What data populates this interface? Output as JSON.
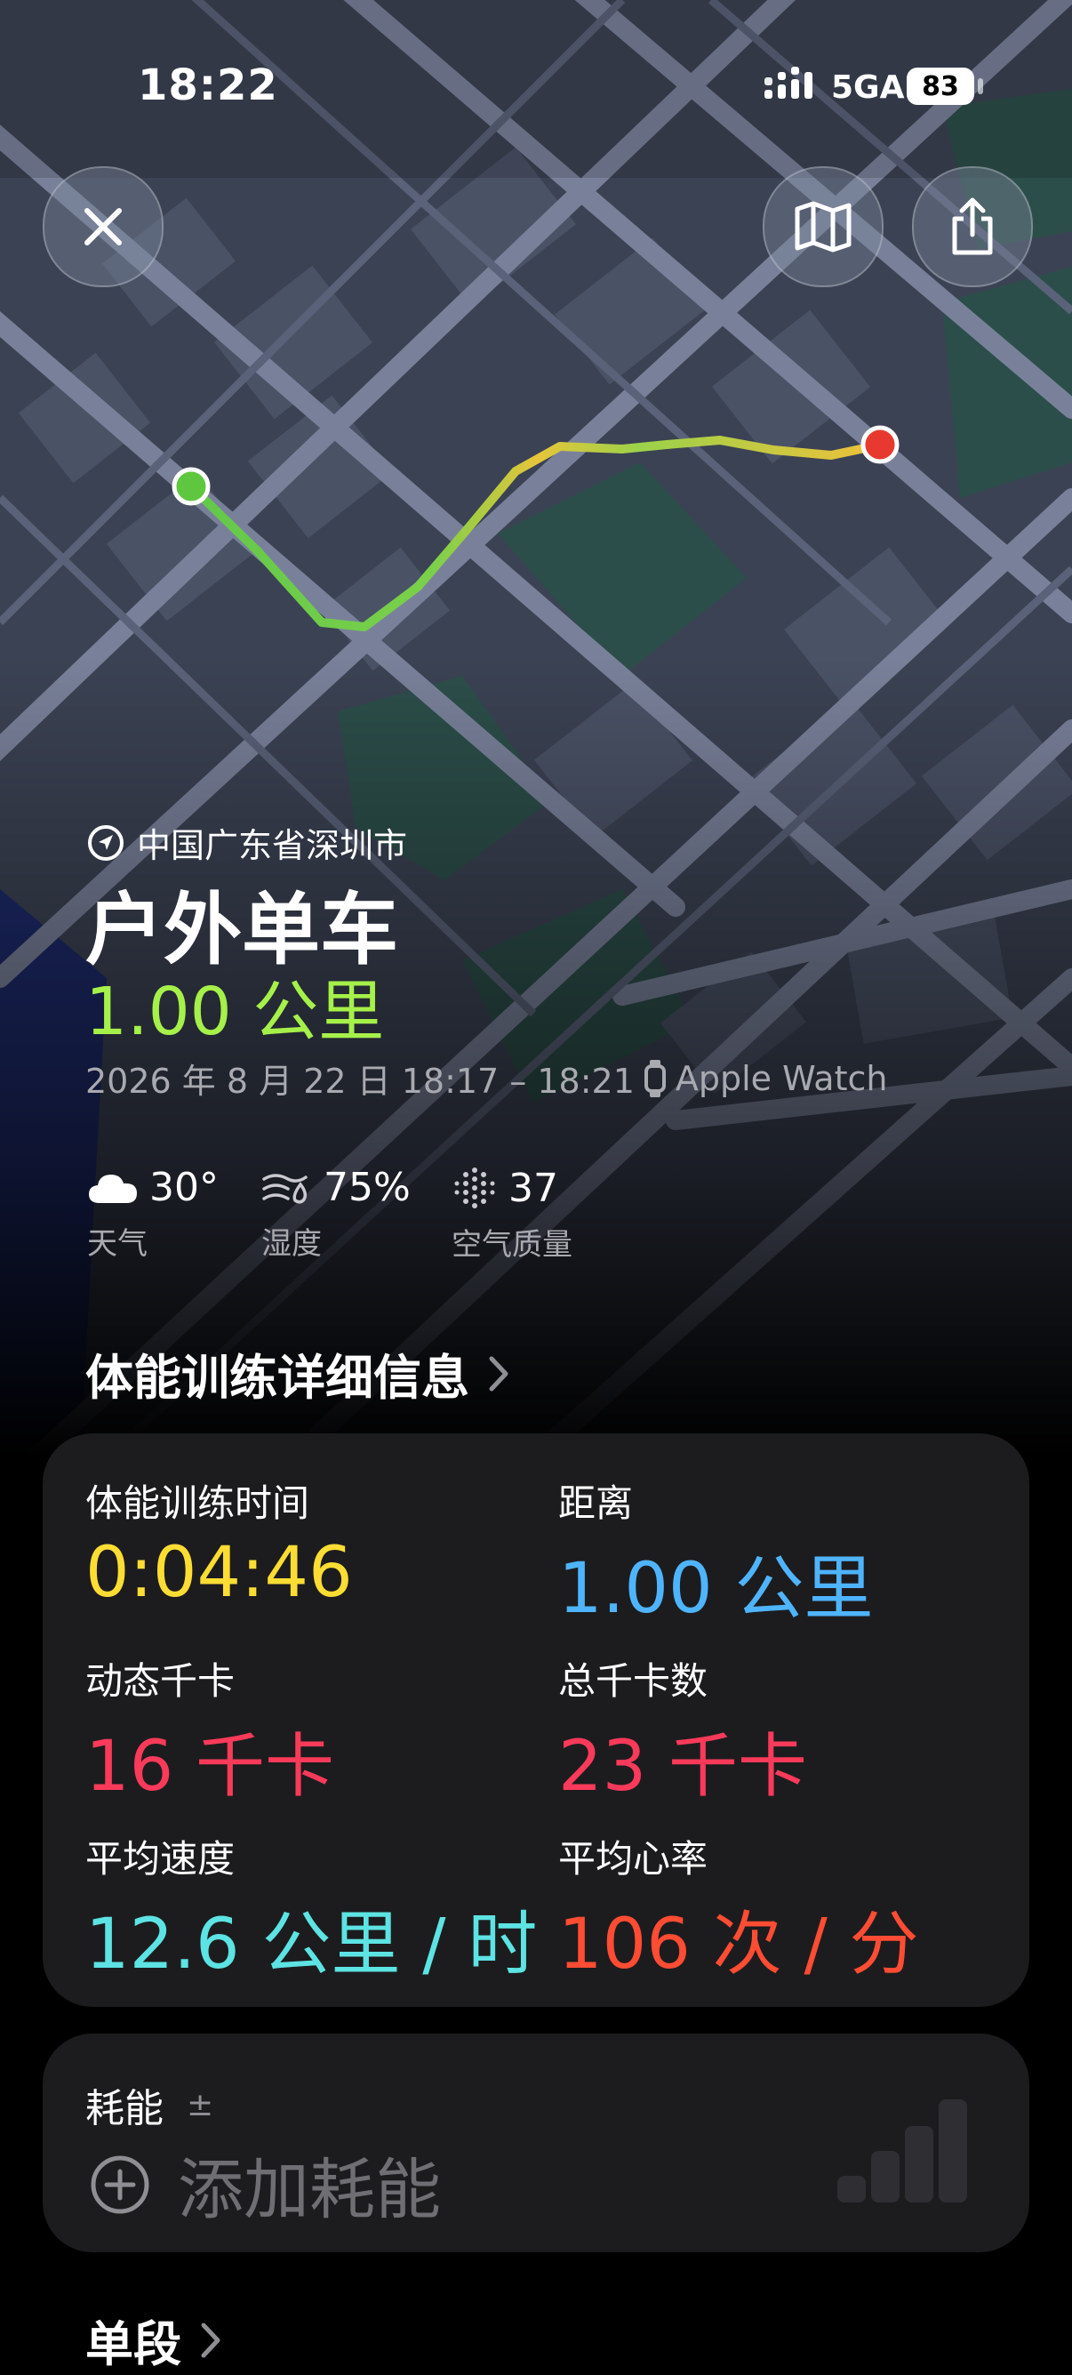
{
  "status_bar": {
    "time": "18:22",
    "network": "5GA",
    "battery": "83"
  },
  "location": "中国广东省深圳市",
  "workout": {
    "title": "户外单车",
    "distance": "1.00 公里",
    "date_range": "2026 年 8 月 22 日 18:17 – 18:21",
    "device": "Apple Watch"
  },
  "weather": [
    {
      "value": "30°",
      "label": "天气",
      "icon": "cloud-icon"
    },
    {
      "value": "75%",
      "label": "湿度",
      "icon": "humidity-icon"
    },
    {
      "value": "37",
      "label": "空气质量",
      "icon": "air-quality-icon"
    }
  ],
  "details": {
    "title": "体能训练详细信息",
    "metrics": [
      {
        "label": "体能训练时间",
        "value": "0:04:46",
        "color": "#fddd33"
      },
      {
        "label": "距离",
        "value": "1.00 公里",
        "color": "#4fb4ff"
      },
      {
        "label": "动态千卡",
        "value": "16 千卡",
        "color": "#fa3a5a"
      },
      {
        "label": "总千卡数",
        "value": "23 千卡",
        "color": "#fa3a5a"
      },
      {
        "label": "平均速度",
        "value": "12.6 公里 / 时",
        "color": "#5de3e3"
      },
      {
        "label": "平均心率",
        "value": "106 次 / 分",
        "color": "#ff4c33"
      }
    ]
  },
  "energy": {
    "label": "耗能",
    "badge": "±",
    "add_label": "添加耗能"
  },
  "next_section": {
    "title": "单段"
  },
  "colors": {
    "accent_green": "#a6f04a",
    "route_start": "#5fc73f",
    "route_end": "#e8392f"
  }
}
